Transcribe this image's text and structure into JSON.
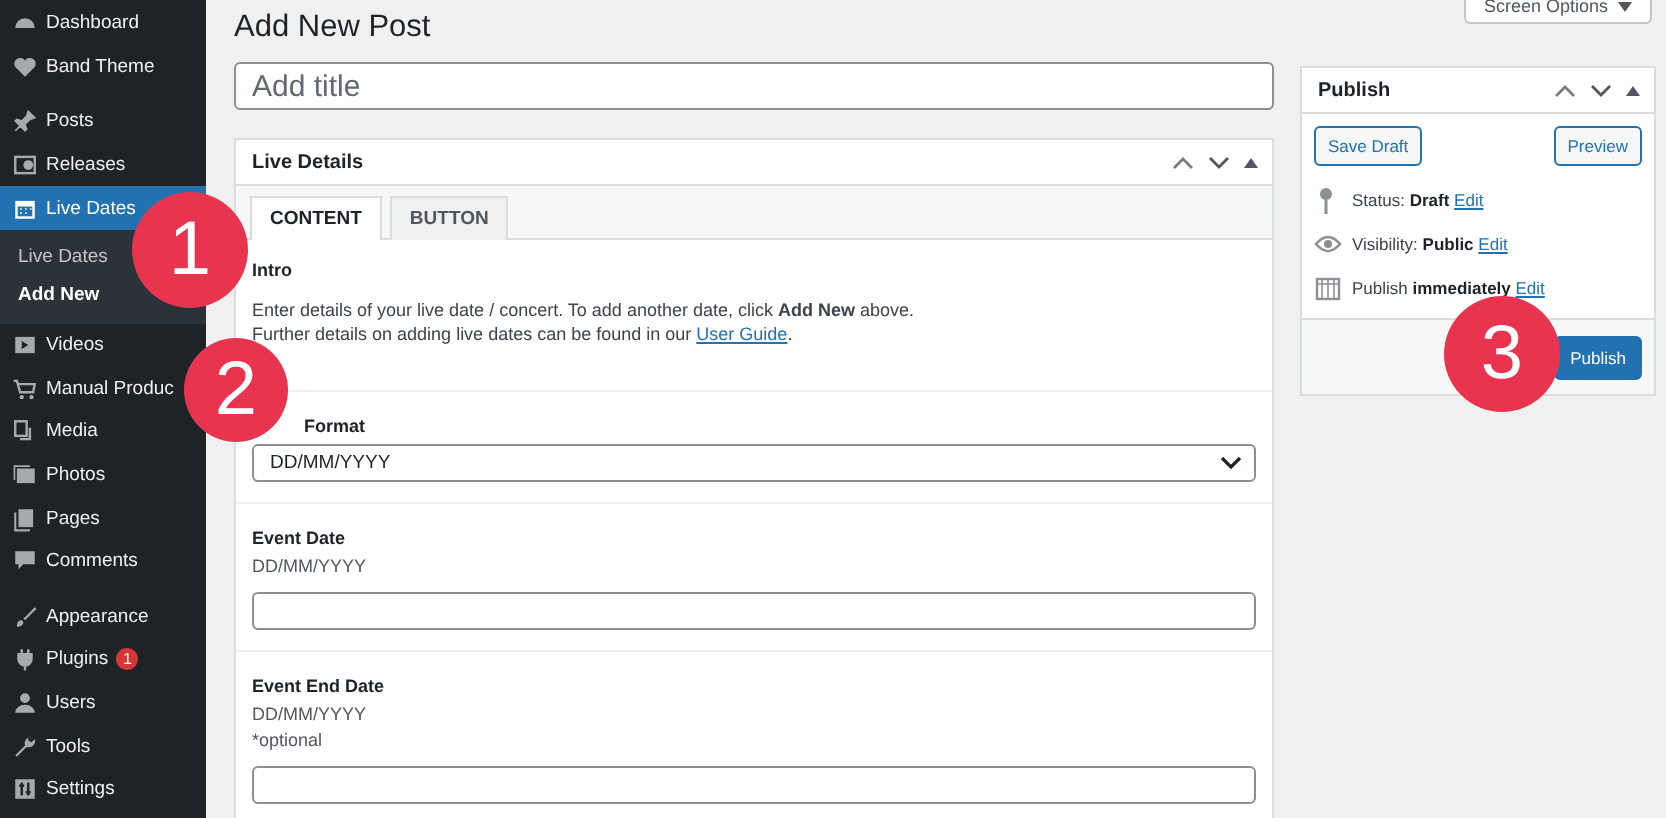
{
  "sidebar": {
    "items": [
      {
        "label": "Dashboard",
        "selected": false
      },
      {
        "label": "Band Theme",
        "selected": false
      },
      {
        "label": "Posts",
        "selected": false
      },
      {
        "label": "Releases",
        "selected": false
      },
      {
        "label": "Live Dates",
        "selected": true,
        "children": [
          {
            "label": "Live Dates",
            "selected": false
          },
          {
            "label": "Add New",
            "selected": true
          }
        ]
      },
      {
        "label": "Videos",
        "selected": false
      },
      {
        "label": "Manual Produc",
        "selected": false
      },
      {
        "label": "Media",
        "selected": false
      },
      {
        "label": "Photos",
        "selected": false
      },
      {
        "label": "Pages",
        "selected": false
      },
      {
        "label": "Comments",
        "selected": false
      },
      {
        "label": "Appearance",
        "selected": false
      },
      {
        "label": "Plugins",
        "selected": false,
        "badge": "1"
      },
      {
        "label": "Users",
        "selected": false
      },
      {
        "label": "Tools",
        "selected": false
      },
      {
        "label": "Settings",
        "selected": false
      }
    ]
  },
  "screen_options": "Screen Options",
  "page_title": "Add New Post",
  "title_field": {
    "placeholder": "Add title"
  },
  "live_details": {
    "title": "Live Details",
    "tabs": [
      {
        "label": "CONTENT",
        "selected": true
      },
      {
        "label": "BUTTON",
        "selected": false
      }
    ],
    "intro": {
      "heading": "Intro",
      "line_1": "Enter details of your live date / concert. To add another date, click **Add New** above.",
      "line_2": "Further details on adding live dates can be found in our",
      "link": "User Guide",
      "line_2_end": "."
    },
    "fields": [
      {
        "kind": "select",
        "label": "Format",
        "value": "DD/MM/YYYY"
      },
      {
        "kind": "text",
        "label": "Event Date",
        "hints": [
          "DD/MM/YYYY"
        ]
      },
      {
        "kind": "text",
        "label": "Event End Date",
        "hints": [
          "DD/MM/YYYY",
          "*optional"
        ]
      }
    ]
  },
  "publish": {
    "title": "Publish",
    "save_draft": "Save Draft",
    "preview": "Preview",
    "rows": [
      {
        "text": "Status: **Draft**",
        "link": "Edit"
      },
      {
        "text": "Visibility: **Public**",
        "link": "Edit"
      },
      {
        "text": "Publish **immediately**",
        "link": "Edit"
      }
    ],
    "publish_button": "Publish"
  },
  "callouts": [
    {
      "number": "1"
    },
    {
      "number": "2"
    },
    {
      "number": "3"
    }
  ]
}
